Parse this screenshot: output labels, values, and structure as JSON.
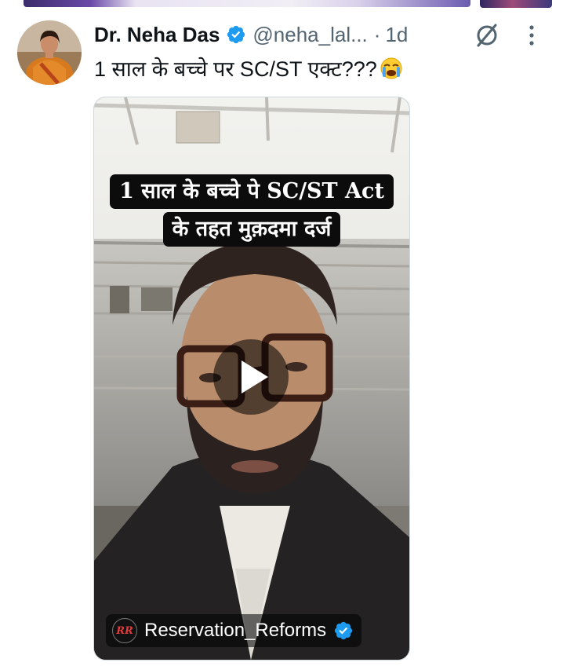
{
  "post": {
    "author_name": "Dr. Neha Das",
    "handle": "@neha_lal...",
    "separator": "·",
    "timestamp": "1d",
    "text": "1 साल के बच्चे पर SC/ST एक्ट???",
    "text_emoji": "loudly-crying-face"
  },
  "media": {
    "type": "video",
    "caption_line1": "1 साल के बच्चे पे SC/ST Act",
    "caption_line2": "के तहत मुक़दमा दर्ज",
    "channel_name": "Reservation_Reforms",
    "channel_logo_text": "RR"
  },
  "icons": {
    "verified": "verified-badge-icon",
    "grok": "grok-icon",
    "more": "more-options-icon",
    "play": "play-icon"
  },
  "colors": {
    "text_primary": "#0f1419",
    "text_secondary": "#536471",
    "verified_blue": "#1d9bf0"
  }
}
